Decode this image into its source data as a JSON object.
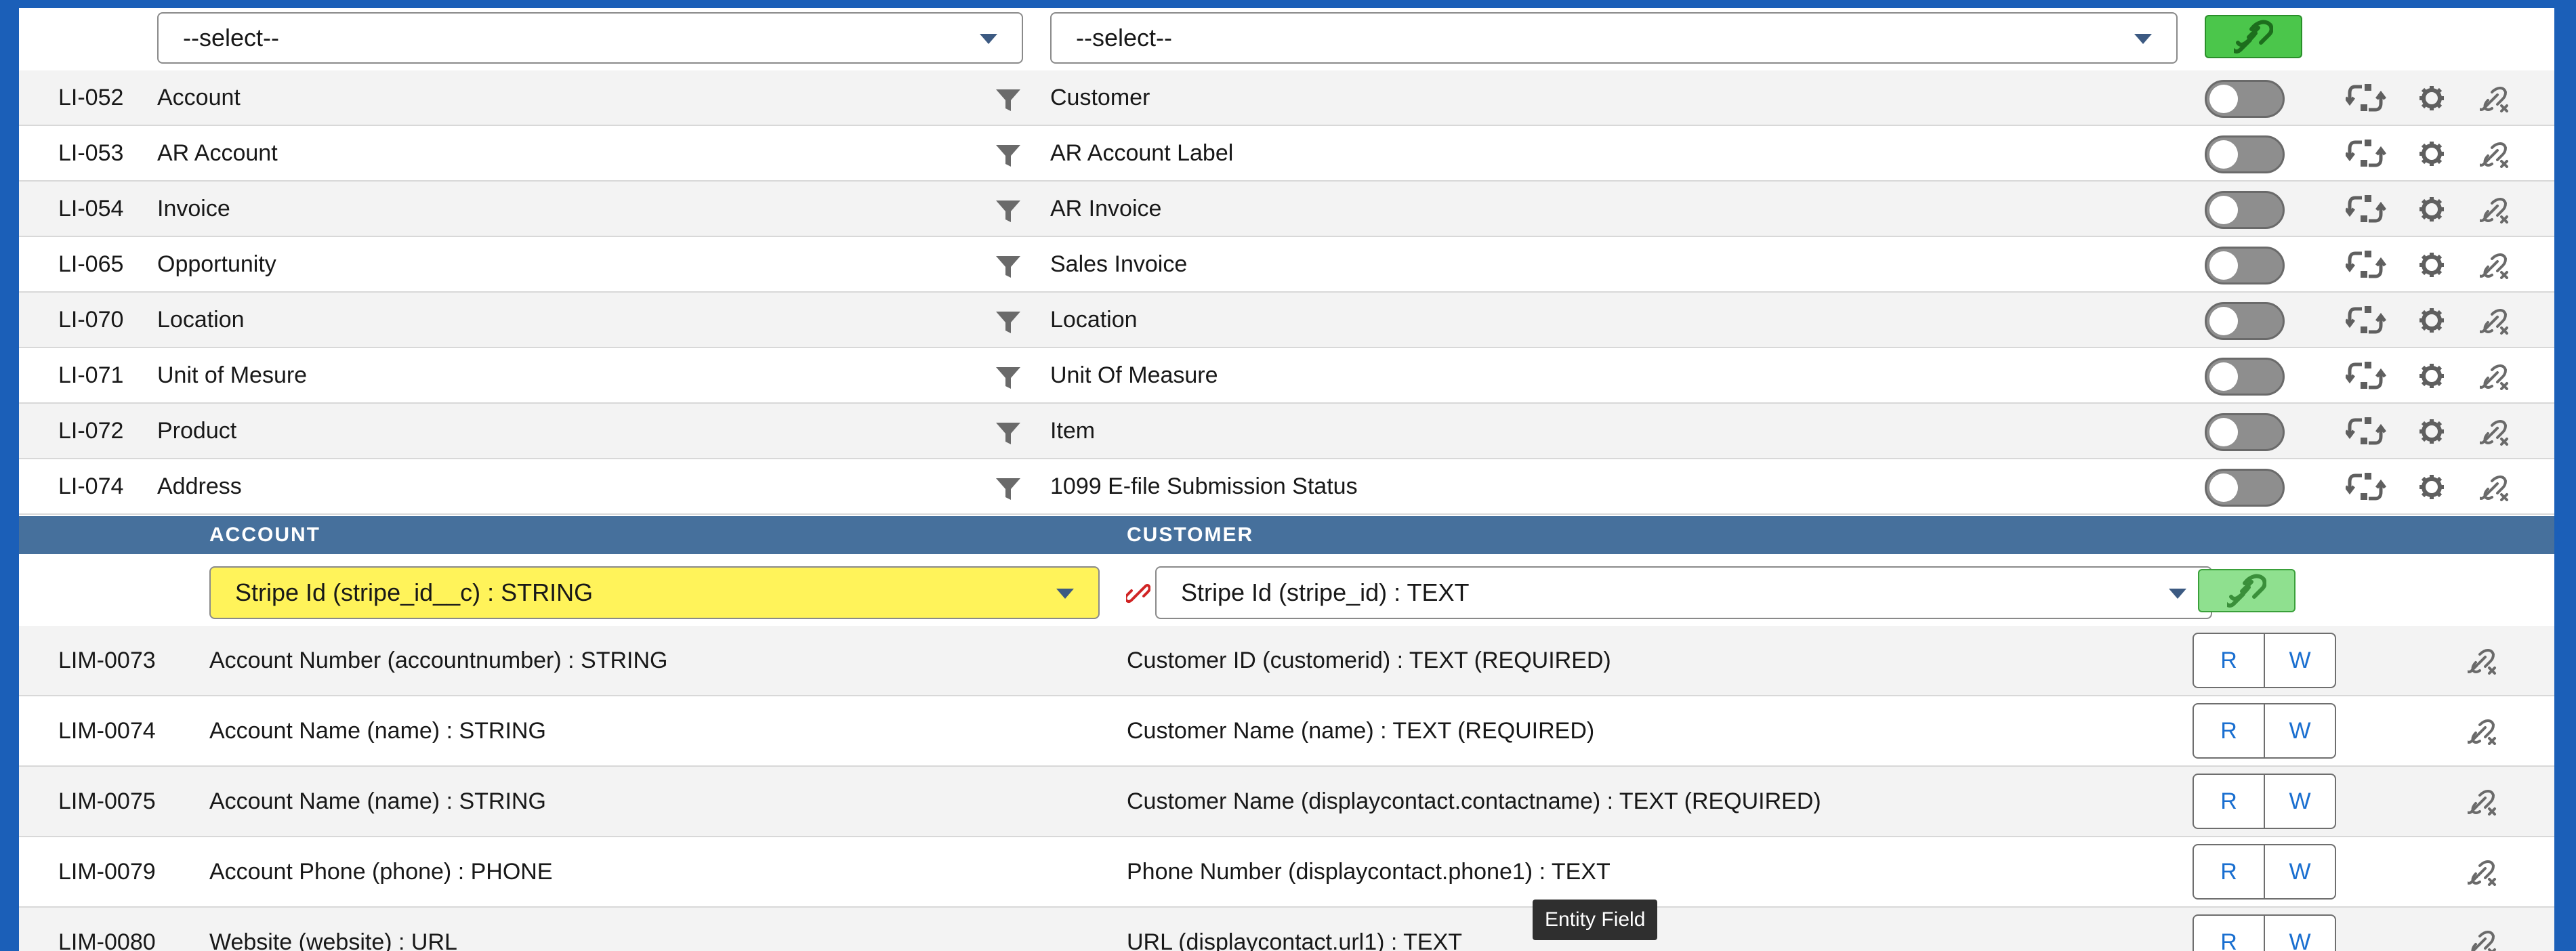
{
  "top_bar": {
    "left_select": "--select--",
    "right_select": "--select--"
  },
  "mappings": [
    {
      "id": "LI-052",
      "source": "Account",
      "target": "Customer"
    },
    {
      "id": "LI-053",
      "source": "AR Account",
      "target": "AR Account Label"
    },
    {
      "id": "LI-054",
      "source": "Invoice",
      "target": "AR Invoice"
    },
    {
      "id": "LI-065",
      "source": "Opportunity",
      "target": "Sales Invoice"
    },
    {
      "id": "LI-070",
      "source": "Location",
      "target": "Location"
    },
    {
      "id": "LI-071",
      "source": "Unit of Mesure",
      "target": "Unit Of Measure"
    },
    {
      "id": "LI-072",
      "source": "Product",
      "target": "Item"
    },
    {
      "id": "LI-074",
      "source": "Address",
      "target": "1099 E-file Submission Status"
    }
  ],
  "field_header": {
    "left": "ACCOUNT",
    "right": "CUSTOMER"
  },
  "field_selects": {
    "left": "Stripe Id (stripe_id__c) : STRING",
    "right": "Stripe Id (stripe_id) : TEXT"
  },
  "field_mappings": [
    {
      "id": "LIM-0073",
      "source": "Account Number (accountnumber) : STRING",
      "target": "Customer ID (customerid) : TEXT (REQUIRED)"
    },
    {
      "id": "LIM-0074",
      "source": "Account Name (name) : STRING",
      "target": "Customer Name (name) : TEXT (REQUIRED)"
    },
    {
      "id": "LIM-0075",
      "source": "Account Name (name) : STRING",
      "target": "Customer Name (displaycontact.contactname) : TEXT (REQUIRED)"
    },
    {
      "id": "LIM-0079",
      "source": "Account Phone (phone) : PHONE",
      "target": "Phone Number (displaycontact.phone1) : TEXT"
    },
    {
      "id": "LIM-0080",
      "source": "Website (website) : URL",
      "target": "URL (displaycontact.url1) : TEXT"
    }
  ],
  "rw_labels": {
    "read": "R",
    "write": "W"
  },
  "tooltip": "Entity Field",
  "colors": {
    "frame_blue": "#1b5fb8",
    "header_band": "#46709c",
    "link_green": "#4bc64b",
    "highlight_yellow": "#fff35a",
    "rw_blue": "#1a6fd0"
  },
  "icons": {
    "filter": "filter-icon",
    "sync": "sync-arrows-icon",
    "settings": "gear-icon",
    "unlink": "unlink-icon",
    "link": "link-icon"
  }
}
